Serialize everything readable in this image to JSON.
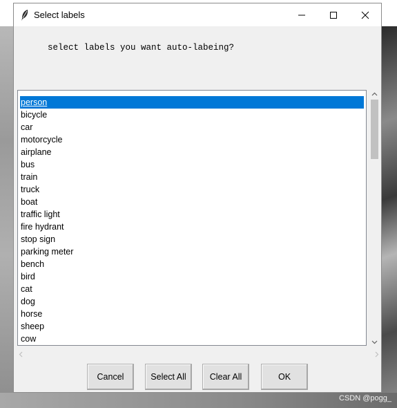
{
  "window": {
    "title": "Select labels",
    "prompt": "select labels you want auto-labeing?"
  },
  "listbox": {
    "selected_index": 0,
    "items": [
      "person",
      "bicycle",
      "car",
      "motorcycle",
      "airplane",
      "bus",
      "train",
      "truck",
      "boat",
      "traffic light",
      "fire hydrant",
      "stop sign",
      "parking meter",
      "bench",
      "bird",
      "cat",
      "dog",
      "horse",
      "sheep",
      "cow"
    ]
  },
  "buttons": {
    "cancel": "Cancel",
    "select_all": "Select All",
    "clear_all": "Clear All",
    "ok": "OK"
  },
  "watermark": "CSDN @pogg_",
  "colors": {
    "selection": "#0078d7",
    "window_bg": "#f0f0f0",
    "button_bg": "#e1e1e1"
  },
  "icons": {
    "title": "feather-icon",
    "minimize": "minimize-icon",
    "maximize": "maximize-icon",
    "close": "close-icon"
  }
}
